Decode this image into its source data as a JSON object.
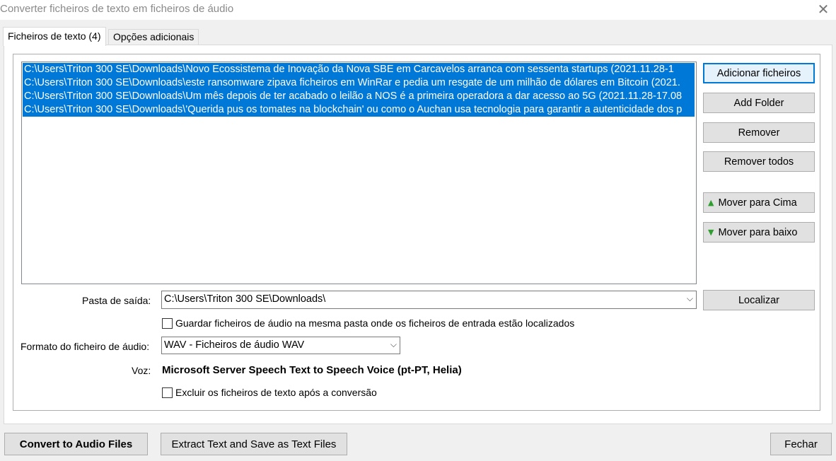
{
  "window": {
    "title": "Converter ficheiros de texto em ficheiros de áudio",
    "close_icon": "close-icon"
  },
  "tabs": [
    {
      "label": "Ficheiros de texto (4)",
      "active": true
    },
    {
      "label": "Opções adicionais",
      "active": false
    }
  ],
  "files": [
    "C:\\Users\\Triton 300 SE\\Downloads\\Novo Ecossistema de Inovação da Nova SBE em Carcavelos arranca com sessenta startups (2021.11.28-1",
    "C:\\Users\\Triton 300 SE\\Downloads\\este ransomware zipava ficheiros em WinRar e pedia um resgate de um milhão de dólares em Bitcoin (2021.",
    "C:\\Users\\Triton 300 SE\\Downloads\\Um mês depois de ter acabado o leilão a NOS é a primeira operadora a dar acesso ao 5G (2021.11.28-17.08",
    "C:\\Users\\Triton 300 SE\\Downloads\\'Querida pus os tomates na blockchain' ou como o Auchan usa tecnologia para garantir a autenticidade dos p"
  ],
  "side_buttons": {
    "add_files": "Adicionar ficheiros",
    "add_folder": "Add Folder",
    "remove": "Remover",
    "remove_all": "Remover todos",
    "move_up": "Mover para Cima",
    "move_down": "Mover para baixo",
    "locate": "Localizar"
  },
  "output": {
    "label": "Pasta de saída:",
    "value": "C:\\Users\\Triton 300 SE\\Downloads\\",
    "same_folder_label": "Guardar ficheiros de áudio na mesma pasta onde os ficheiros de entrada estão localizados",
    "same_folder_checked": false
  },
  "format": {
    "label": "Formato do ficheiro de áudio:",
    "value": "WAV - Ficheiros de áudio WAV"
  },
  "voice": {
    "label": "Voz:",
    "value": "Microsoft Server Speech Text to Speech Voice (pt-PT, Helia)"
  },
  "delete_after": {
    "label": "Excluir os ficheiros de texto após a conversão",
    "checked": false
  },
  "bottom": {
    "convert": "Convert to Audio Files",
    "extract": "Extract Text and Save as Text Files",
    "close": "Fechar"
  },
  "colors": {
    "selection": "#0078d7",
    "arrow_green": "#2e9e2e"
  }
}
